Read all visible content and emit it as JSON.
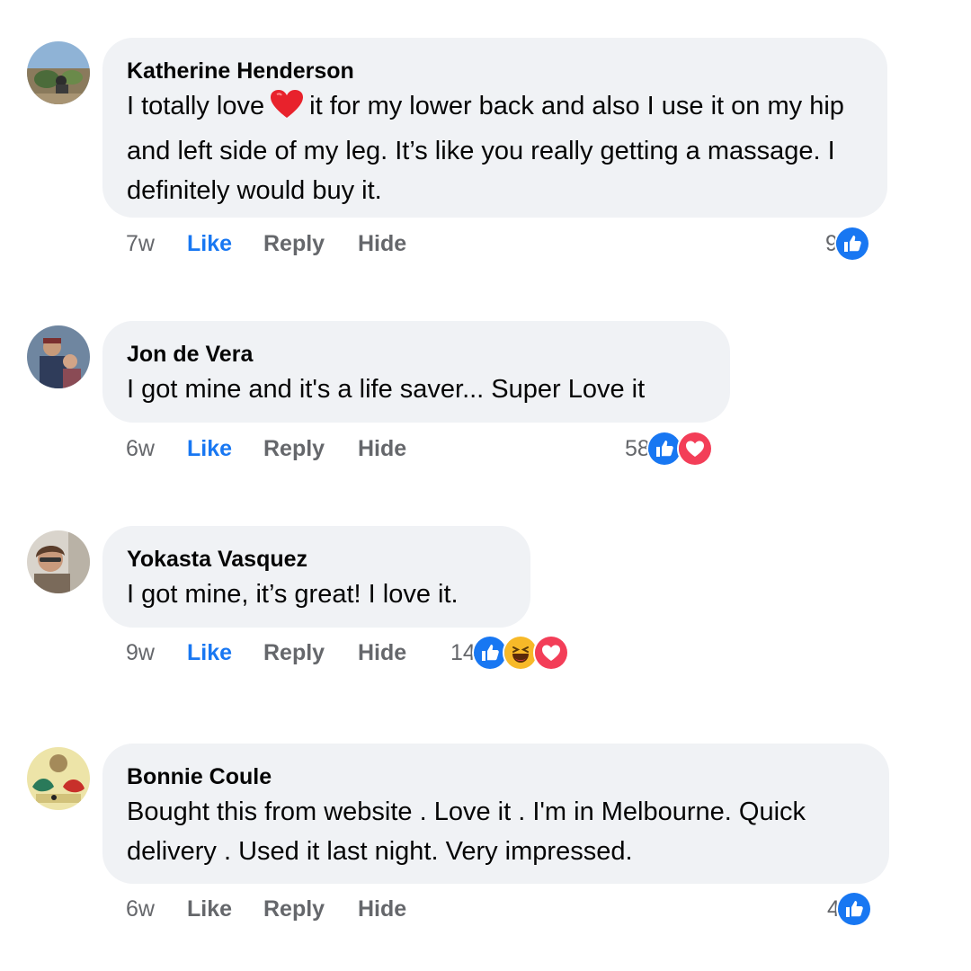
{
  "comments": [
    {
      "author": "Katherine Henderson",
      "text_before_emoji": "I totally love",
      "text_after_emoji": "it for my lower back and also I use it on my hip and left side of my leg. It’s like you really getting a massage. I definitely would buy it.",
      "time": "7w",
      "like_label": "Like",
      "like_active": true,
      "reply_label": "Reply",
      "hide_label": "Hide",
      "reaction_count": "9",
      "reactions": [
        "like-icon"
      ]
    },
    {
      "author": "Jon de Vera",
      "text": "I got mine and it's a life saver... Super Love it",
      "time": "6w",
      "like_label": "Like",
      "like_active": true,
      "reply_label": "Reply",
      "hide_label": "Hide",
      "reaction_count": "58",
      "reactions": [
        "like-icon",
        "love-icon"
      ]
    },
    {
      "author": "Yokasta Vasquez",
      "text": "I got mine, it’s great! I love it.",
      "time": "9w",
      "like_label": "Like",
      "like_active": true,
      "reply_label": "Reply",
      "hide_label": "Hide",
      "reaction_count": "14",
      "reactions": [
        "like-icon",
        "haha-icon",
        "love-icon"
      ]
    },
    {
      "author": "Bonnie Coule",
      "text": "Bought this from website . Love it . I'm in Melbourne. Quick delivery . Used it last night. Very impressed.",
      "time": "6w",
      "like_label": "Like",
      "like_active": false,
      "reply_label": "Reply",
      "hide_label": "Hide",
      "reaction_count": "4",
      "reactions": [
        "like-icon"
      ]
    }
  ],
  "colors": {
    "like_blue": "#1877f2",
    "love_red": "#f33e58",
    "bubble_bg": "#f0f2f5",
    "meta_grey": "#65676b"
  }
}
